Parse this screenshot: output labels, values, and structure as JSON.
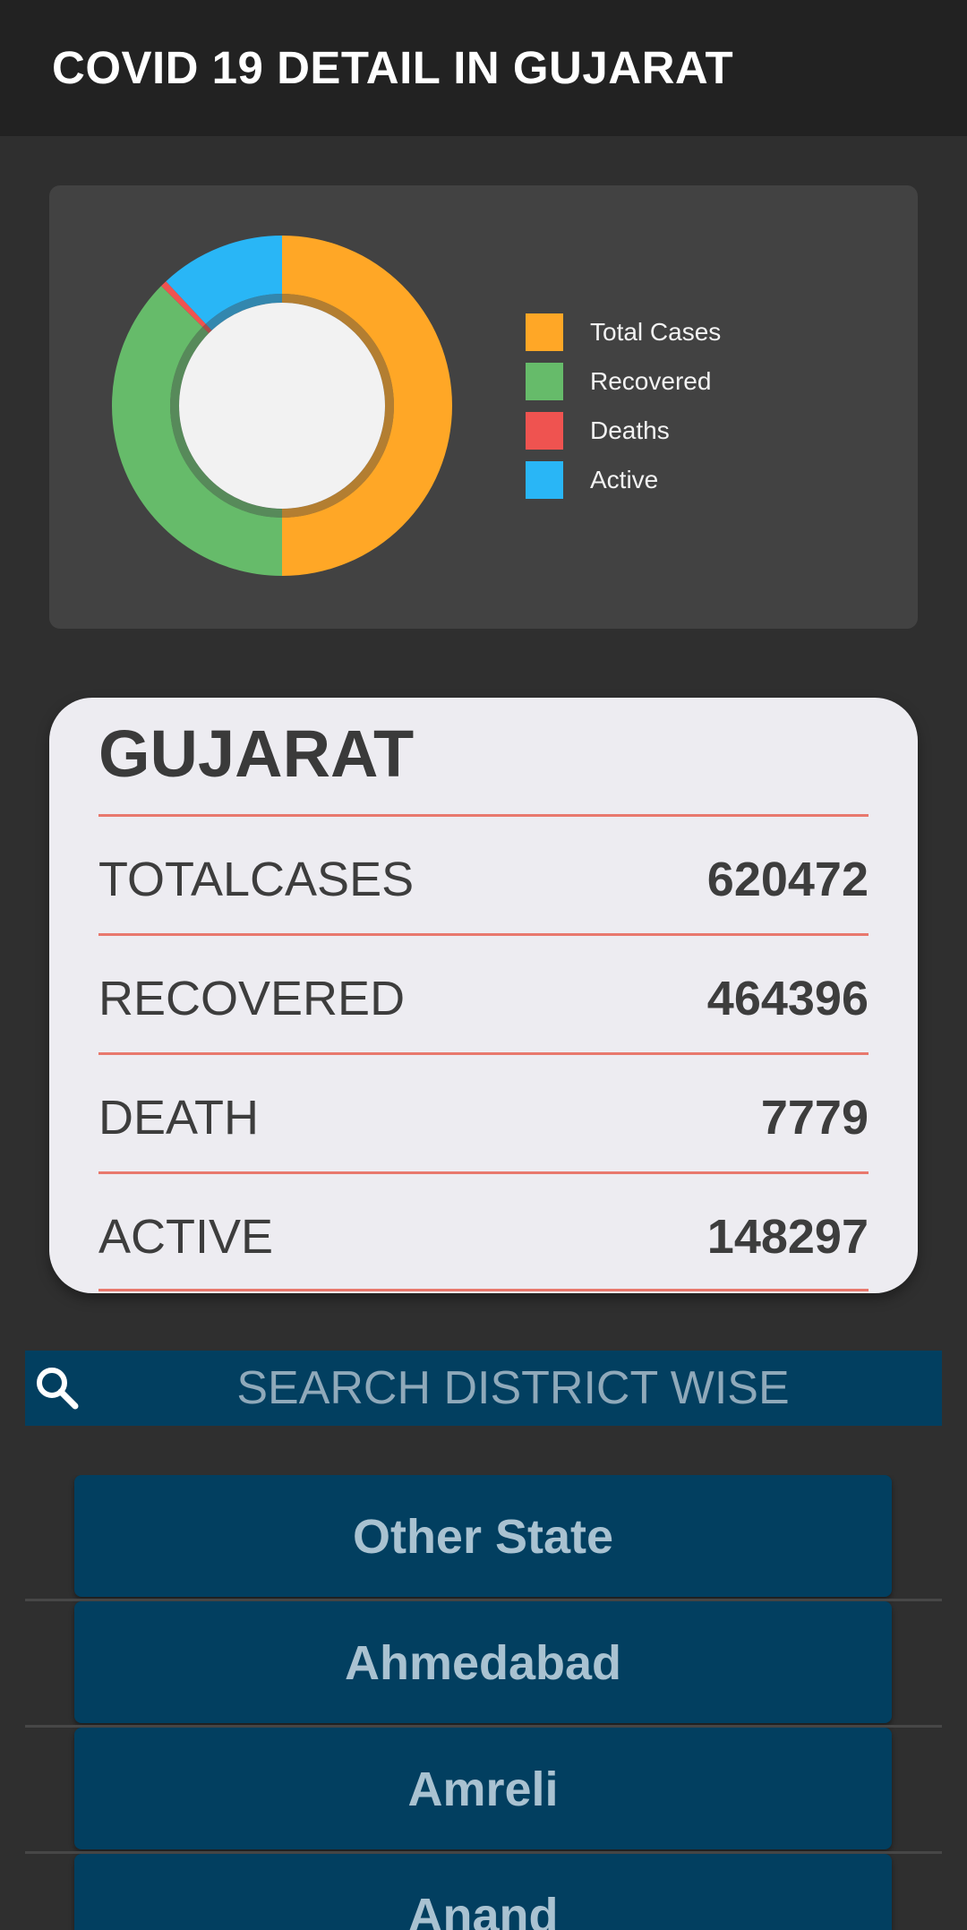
{
  "appbar": {
    "title": "COVID 19 DETAIL IN GUJARAT"
  },
  "chart_data": {
    "type": "pie",
    "donut": true,
    "categories": [
      "Total Cases",
      "Recovered",
      "Deaths",
      "Active"
    ],
    "values": [
      620472,
      464396,
      7779,
      148297
    ],
    "colors": [
      "#ffa726",
      "#66bb6a",
      "#ef5350",
      "#29b6f6"
    ],
    "legend_position": "right"
  },
  "legend": {
    "items": [
      {
        "label": "Total Cases",
        "color": "#ffa726"
      },
      {
        "label": "Recovered",
        "color": "#66bb6a"
      },
      {
        "label": "Deaths",
        "color": "#ef5350"
      },
      {
        "label": "Active",
        "color": "#29b6f6"
      }
    ]
  },
  "stats": {
    "title": "GUJARAT",
    "rows": [
      {
        "label": "TOTALCASES",
        "value": "620472"
      },
      {
        "label": "RECOVERED",
        "value": "464396"
      },
      {
        "label": "DEATH",
        "value": "7779"
      },
      {
        "label": "ACTIVE",
        "value": "148297"
      }
    ]
  },
  "search": {
    "placeholder": "SEARCH DISTRICT WISE",
    "icon": "search-icon"
  },
  "districts": [
    {
      "label": "Other State"
    },
    {
      "label": "Ahmedabad"
    },
    {
      "label": "Amreli"
    },
    {
      "label": "Anand"
    }
  ]
}
